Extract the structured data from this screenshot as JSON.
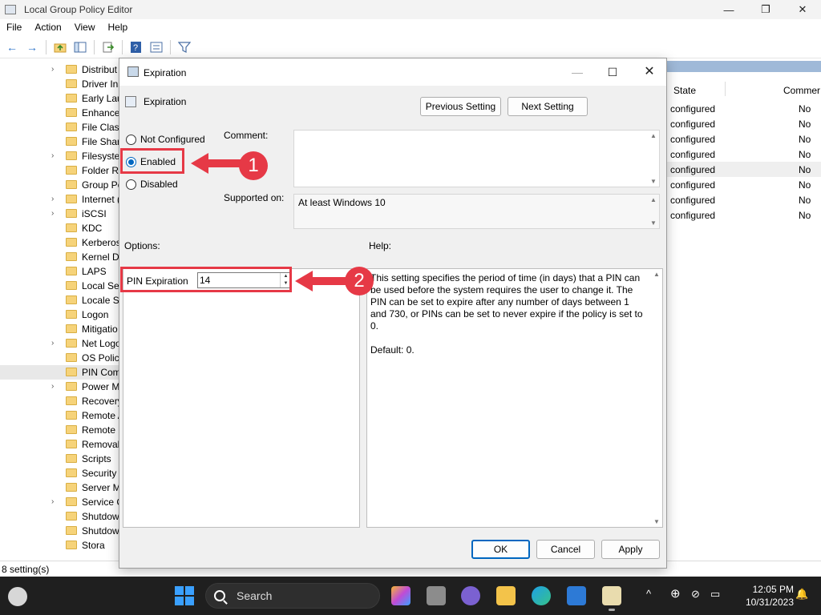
{
  "window": {
    "title": "Local Group Policy Editor",
    "min": "—",
    "max": "❐",
    "close": "✕"
  },
  "menu": [
    "File",
    "Action",
    "View",
    "Help"
  ],
  "tree": {
    "items": [
      {
        "label": "Distribut",
        "chev": "›"
      },
      {
        "label": "Driver Ins",
        "chev": ""
      },
      {
        "label": "Early Lau",
        "chev": ""
      },
      {
        "label": "Enhance",
        "chev": ""
      },
      {
        "label": "File Class",
        "chev": ""
      },
      {
        "label": "File Shar",
        "chev": ""
      },
      {
        "label": "Filesyste",
        "chev": "›"
      },
      {
        "label": "Folder Re",
        "chev": ""
      },
      {
        "label": "Group Po",
        "chev": ""
      },
      {
        "label": "Internet (",
        "chev": "›"
      },
      {
        "label": "iSCSI",
        "chev": "›"
      },
      {
        "label": "KDC",
        "chev": ""
      },
      {
        "label": "Kerberos",
        "chev": ""
      },
      {
        "label": "Kernel DI",
        "chev": ""
      },
      {
        "label": "LAPS",
        "chev": ""
      },
      {
        "label": "Local Sec",
        "chev": ""
      },
      {
        "label": "Locale Se",
        "chev": ""
      },
      {
        "label": "Logon",
        "chev": ""
      },
      {
        "label": "Mitigatio",
        "chev": ""
      },
      {
        "label": "Net Logo",
        "chev": "›"
      },
      {
        "label": "OS Polici",
        "chev": ""
      },
      {
        "label": "PIN Com",
        "chev": ""
      },
      {
        "label": "Power M",
        "chev": "›"
      },
      {
        "label": "Recovery",
        "chev": ""
      },
      {
        "label": "Remote A",
        "chev": ""
      },
      {
        "label": "Remote I",
        "chev": ""
      },
      {
        "label": "Removal",
        "chev": ""
      },
      {
        "label": "Scripts",
        "chev": ""
      },
      {
        "label": "Security",
        "chev": ""
      },
      {
        "label": "Server M",
        "chev": ""
      },
      {
        "label": "Service C",
        "chev": "›"
      },
      {
        "label": "Shutdow",
        "chev": ""
      },
      {
        "label": "Shutdow",
        "chev": ""
      },
      {
        "label": "Stora",
        "chev": ""
      }
    ],
    "selected_index": 21
  },
  "list": {
    "col_state": "State",
    "col_comment": "Commer",
    "rows": [
      {
        "state": "configured",
        "comment": "No"
      },
      {
        "state": "configured",
        "comment": "No"
      },
      {
        "state": "configured",
        "comment": "No"
      },
      {
        "state": "configured",
        "comment": "No"
      },
      {
        "state": "configured",
        "comment": "No"
      },
      {
        "state": "configured",
        "comment": "No"
      },
      {
        "state": "configured",
        "comment": "No"
      },
      {
        "state": "configured",
        "comment": "No"
      }
    ],
    "selected_index": 4
  },
  "status": "8 setting(s)",
  "dialog": {
    "title": "Expiration",
    "policy_name": "Expiration",
    "prev_button": "Previous Setting",
    "next_button": "Next Setting",
    "radio": {
      "not_configured": "Not Configured",
      "enabled": "Enabled",
      "disabled": "Disabled",
      "selected": "enabled"
    },
    "comment_label": "Comment:",
    "comment_value": "",
    "supported_label": "Supported on:",
    "supported_value": "At least Windows 10",
    "options_label": "Options:",
    "help_label": "Help:",
    "pin_label": "PIN Expiration",
    "pin_value": "14",
    "help_p1": "This setting specifies the period of time (in days) that a PIN can be used before the system requires the user to change it. The PIN can be set to expire after any number of days between 1 and 730, or PINs can be set to never expire if the policy is set to 0.",
    "help_p2": "Default: 0.",
    "ok": "OK",
    "cancel": "Cancel",
    "apply": "Apply"
  },
  "annotations": {
    "one": "1",
    "two": "2",
    "color": "#e63946"
  },
  "taskbar": {
    "search": "Search",
    "time": "12:05 PM",
    "date": "10/31/2023",
    "accent": "#3aa0ff"
  },
  "icons": {
    "back": "←",
    "forward": "→",
    "up_arrow": "▲",
    "down_arrow": "▼",
    "chevron_up": "^",
    "globe": "⊕",
    "bell": "🔔"
  }
}
